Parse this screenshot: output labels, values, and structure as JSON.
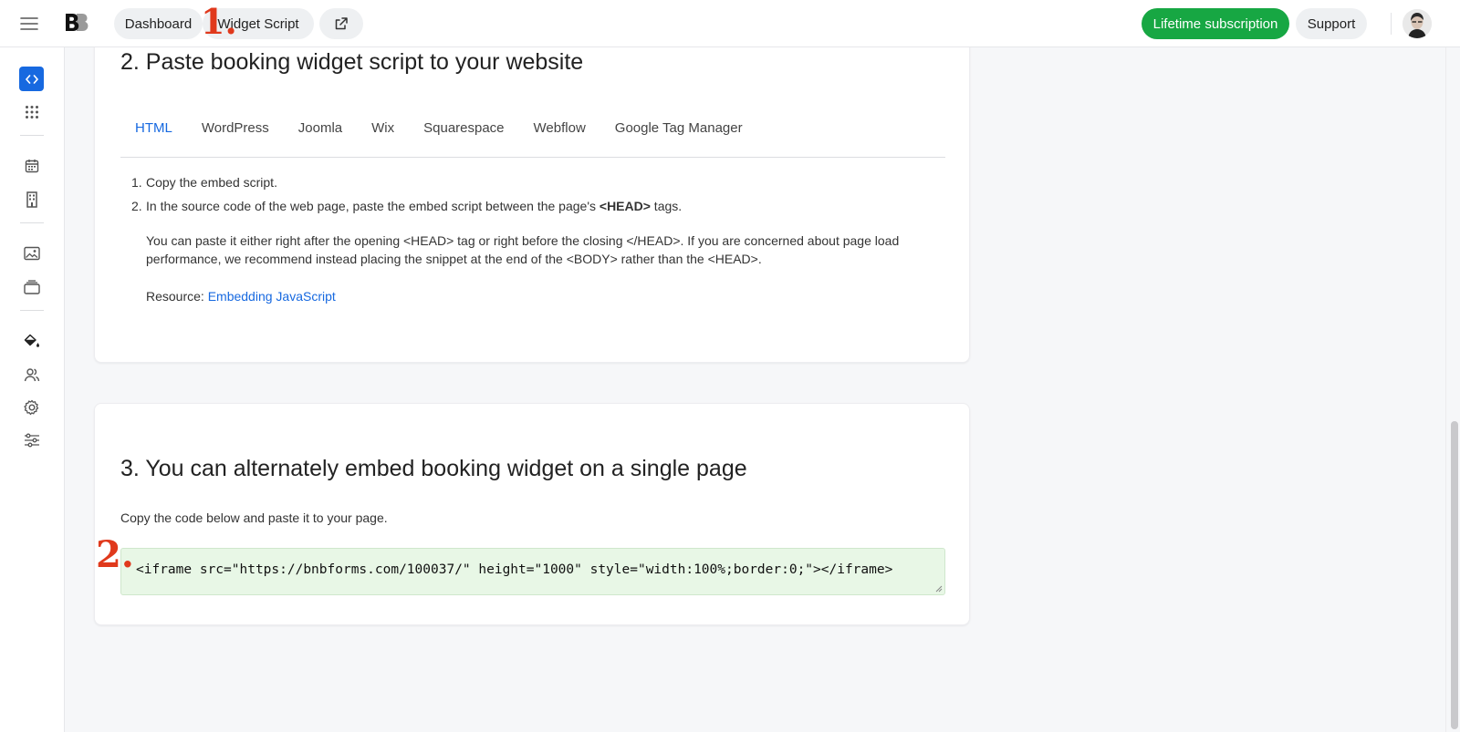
{
  "topbar": {
    "dashboard_label": "Dashboard",
    "widget_label": "Widget Script",
    "lifetime_label": "Lifetime subscription",
    "support_label": "Support",
    "brand_color": "#17a743"
  },
  "markers": {
    "one": "1.",
    "two": "2."
  },
  "sidebar": {
    "items": [
      {
        "icon": "code-icon",
        "active": true
      },
      {
        "icon": "apps-grid-icon"
      },
      {
        "icon": "calendar-icon"
      },
      {
        "icon": "building-icon"
      },
      {
        "icon": "image-icon"
      },
      {
        "icon": "layers-icon"
      },
      {
        "icon": "paint-bucket-icon"
      },
      {
        "icon": "users-icon"
      },
      {
        "icon": "gear-icon"
      },
      {
        "icon": "sliders-icon"
      }
    ],
    "accent": "#1769e0"
  },
  "section2": {
    "title": "2. Paste booking widget script to your website",
    "tabs": [
      "HTML",
      "WordPress",
      "Joomla",
      "Wix",
      "Squarespace",
      "Webflow",
      "Google Tag Manager"
    ],
    "active_tab": "HTML",
    "step1": "Copy the embed script.",
    "step2_pre": "In the source code of the web page, paste the embed script between the page's ",
    "step2_bold": "<HEAD>",
    "step2_post": " tags.",
    "paragraph": "You can paste it either right after the opening <HEAD> tag or right before the closing </HEAD>. If you are concerned about page load performance, we recommend instead placing the snippet at the end of the <BODY> rather than the <HEAD>.",
    "resource_label": "Resource: ",
    "resource_link": "Embedding JavaScript"
  },
  "section3": {
    "title": "3. You can alternately embed booking widget on a single page",
    "instruction": "Copy the code below and paste it to your page.",
    "code": "<iframe src=\"https://bnbforms.com/100037/\" height=\"1000\" style=\"width:100%;border:0;\"></iframe>"
  }
}
